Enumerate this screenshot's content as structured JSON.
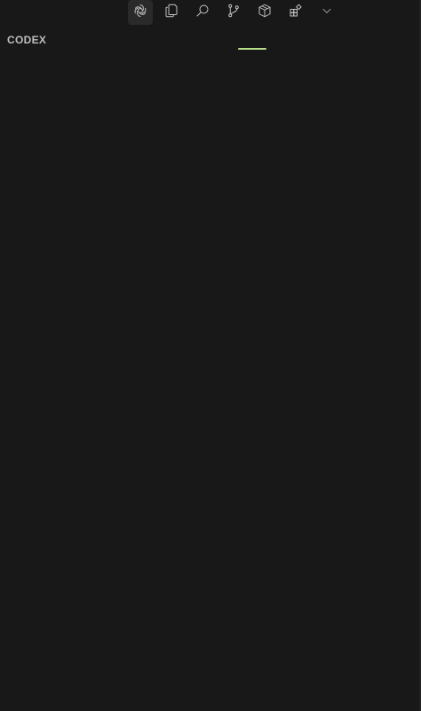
{
  "panel": {
    "title": "CODEX"
  },
  "activity_bar": {
    "items": [
      {
        "icon": "codex-icon",
        "active": true
      },
      {
        "icon": "explorer-icon",
        "active": false
      },
      {
        "icon": "search-icon",
        "active": false
      },
      {
        "icon": "source-control-icon",
        "active": false
      },
      {
        "icon": "package-icon",
        "active": false
      },
      {
        "icon": "extensions-icon",
        "active": false
      },
      {
        "icon": "chevron-down-icon",
        "active": false
      }
    ]
  },
  "colors": {
    "background": "#181818",
    "accent_progress": "#b7e08a",
    "text_muted": "#bdbdbd",
    "icon": "#c5c5c5",
    "active_bg": "#2a2a2a"
  }
}
